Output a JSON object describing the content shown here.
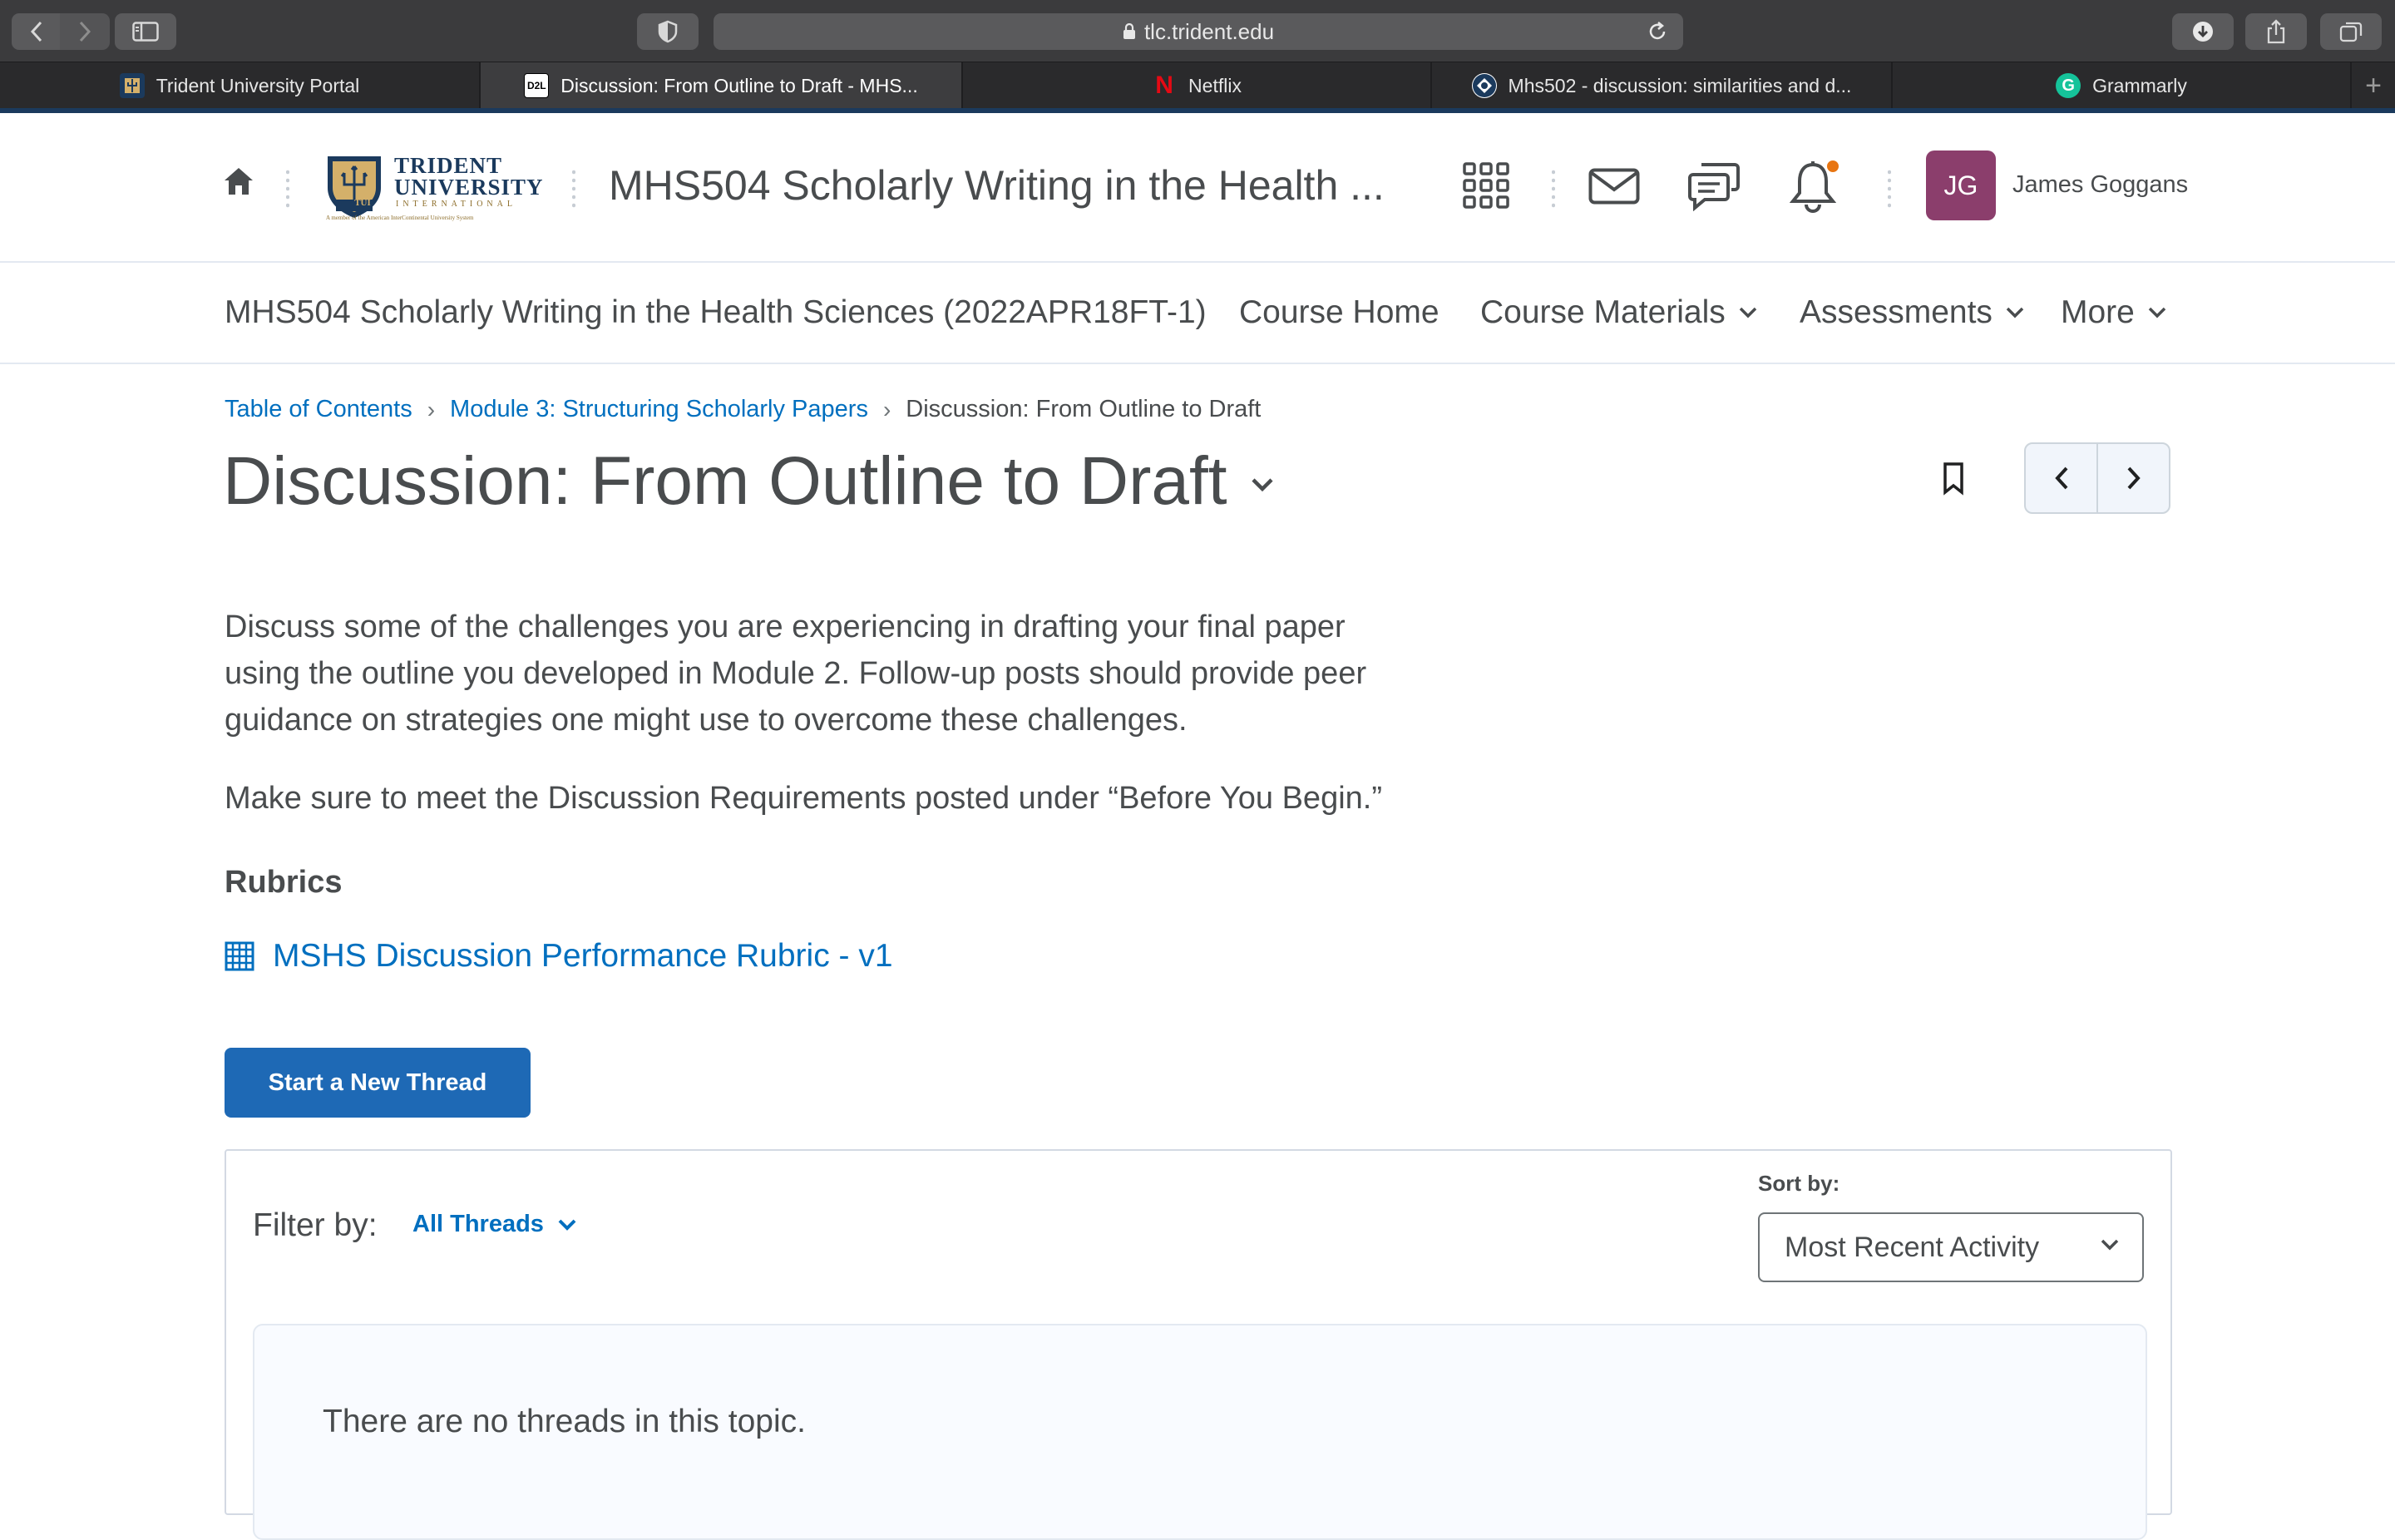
{
  "browser": {
    "url": "tlc.trident.edu",
    "tabs": [
      {
        "label": "Trident University Portal",
        "favicon": "trident-favicon"
      },
      {
        "label": "Discussion: From Outline to Draft - MHS...",
        "favicon": "d2l-favicon",
        "favicon_text": "D2L"
      },
      {
        "label": "Netflix",
        "favicon": "netflix-favicon",
        "favicon_text": "N"
      },
      {
        "label": "Mhs502 - discussion: similarities and d...",
        "favicon": "chegg-favicon"
      },
      {
        "label": "Grammarly",
        "favicon": "grammarly-favicon",
        "favicon_text": "G"
      }
    ],
    "new_tab": "+"
  },
  "header": {
    "logo": {
      "line1": "TRIDENT",
      "line2": "UNIVERSITY",
      "line3": "INTERNATIONAL",
      "tagline": "A member of the American InterContinental University System",
      "seal": "TUI"
    },
    "course_title": "MHS504 Scholarly Writing in the Health ...",
    "avatar_initials": "JG",
    "user_name": "James Goggans"
  },
  "course_nav": {
    "course_name": "MHS504 Scholarly Writing in the Health Sciences (2022APR18FT-1)",
    "home": "Course Home",
    "materials": "Course Materials",
    "assessments": "Assessments",
    "more": "More"
  },
  "breadcrumb": {
    "toc": "Table of Contents",
    "module": "Module 3: Structuring Scholarly Papers",
    "current": "Discussion: From Outline to Draft",
    "separator": "›"
  },
  "page": {
    "title": "Discussion: From Outline to Draft",
    "description": "Discuss some of the challenges you are experiencing in drafting your final paper using the outline you developed in Module 2. Follow-up posts should provide peer guidance on strategies one might use to overcome these challenges.",
    "requirement": "Make sure to meet the Discussion Requirements posted under “Before You Begin.”",
    "rubrics_heading": "Rubrics",
    "rubric_link": "MSHS Discussion Performance Rubric - v1",
    "start_thread": "Start a New Thread"
  },
  "threads": {
    "filter_label": "Filter by:",
    "filter_value": "All Threads",
    "sort_label": "Sort by:",
    "sort_value": "Most Recent Activity",
    "empty_message": "There are no threads in this topic."
  },
  "colors": {
    "link": "#006fbf",
    "primary_button": "#1e69b5",
    "avatar": "#8b3e6c",
    "notification": "#e87511",
    "text": "#494c4e"
  }
}
